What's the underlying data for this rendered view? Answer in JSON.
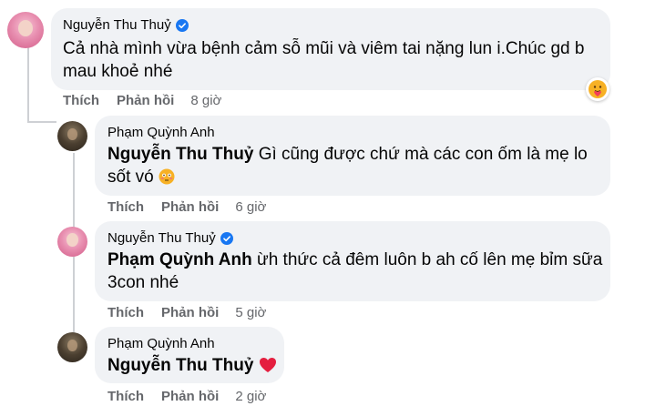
{
  "comments": [
    {
      "author": "Nguyễn Thu Thuỷ",
      "verified": true,
      "mention": "",
      "text": "Cả nhà mình vừa bệnh cảm sỗ mũi và viêm tai nặng lun i.Chúc gd b mau khoẻ nhé",
      "like_label": "Thích",
      "reply_label": "Phản hồi",
      "time": "8 giờ",
      "reaction": "care-emoji"
    },
    {
      "author": "Phạm Quỳnh Anh",
      "verified": false,
      "mention": "Nguyễn Thu Thuỷ",
      "text": " Gì cũng được chứ mà các con ốm là mẹ lo sốt vó",
      "like_label": "Thích",
      "reply_label": "Phản hồi",
      "time": "6 giờ",
      "inline_emoji": "flushed-face-emoji"
    },
    {
      "author": "Nguyễn Thu Thuỷ",
      "verified": true,
      "mention": "Phạm Quỳnh Anh",
      "text": " ừh thức cả đêm luôn b ah cố lên mẹ bỉm sữa 3con nhé",
      "like_label": "Thích",
      "reply_label": "Phản hồi",
      "time": "5 giờ"
    },
    {
      "author": "Phạm Quỳnh Anh",
      "verified": false,
      "mention": "Nguyễn Thu Thuỷ",
      "text": "",
      "like_label": "Thích",
      "reply_label": "Phản hồi",
      "time": "2 giờ",
      "inline_emoji": "red-heart-emoji"
    }
  ],
  "colors": {
    "bubble": "#f0f2f5",
    "secondary_text": "#65676b",
    "verified": "#1877f2",
    "heart": "#e41e3f"
  }
}
